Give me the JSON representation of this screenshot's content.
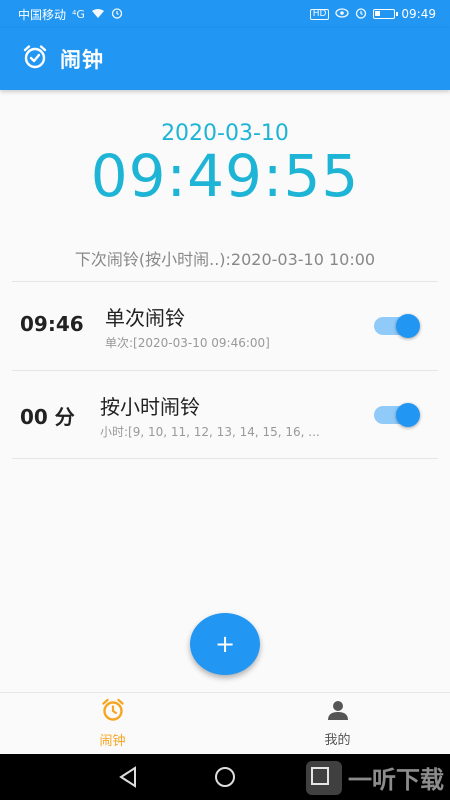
{
  "status_bar": {
    "carrier": "中国移动",
    "signal_label": "⁴G",
    "time": "09:49",
    "hd_label": "HD"
  },
  "app_bar": {
    "title": "闹钟"
  },
  "clock": {
    "date": "2020-03-10",
    "time": "09:49:55"
  },
  "next_alarm": {
    "text": "下次闹铃(按小时闹..):2020-03-10 10:00"
  },
  "alarms": [
    {
      "time": "09:46",
      "title": "单次闹铃",
      "subtitle": "单次:[2020-03-10 09:46:00]",
      "enabled": true
    },
    {
      "time": "00 分",
      "title": "按小时闹铃",
      "subtitle": "小时:[9, 10, 11, 12, 13, 14, 15, 16, ...",
      "enabled": true
    }
  ],
  "fab": {
    "label": "+"
  },
  "bottom_nav": {
    "items": [
      {
        "label": "闹钟",
        "active": true
      },
      {
        "label": "我的",
        "active": false
      }
    ]
  },
  "watermark": {
    "text": "一听下载"
  },
  "colors": {
    "primary": "#2196f3",
    "clock_text": "#1eb4d6",
    "active_nav": "#f5a623"
  }
}
